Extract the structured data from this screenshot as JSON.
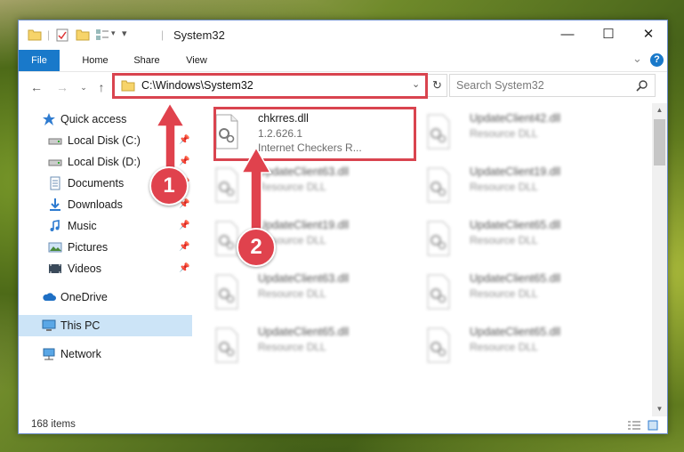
{
  "window": {
    "title": "System32",
    "controls": {
      "minimize": "—",
      "maximize": "☐",
      "close": "✕"
    }
  },
  "ribbon": {
    "tabs": [
      "File",
      "Home",
      "Share",
      "View"
    ],
    "help_glyph": "?",
    "expand_glyph": "⌄"
  },
  "nav": {
    "address": "C:\\Windows\\System32",
    "search_placeholder": "Search System32"
  },
  "sidebar": {
    "items": [
      {
        "label": "Quick access",
        "icon": "star-icon",
        "pinned": false
      },
      {
        "label": "Local Disk (C:)",
        "icon": "drive-icon",
        "pinned": true
      },
      {
        "label": "Local Disk (D:)",
        "icon": "drive-icon",
        "pinned": true
      },
      {
        "label": "Documents",
        "icon": "documents-icon",
        "pinned": true
      },
      {
        "label": "Downloads",
        "icon": "downloads-icon",
        "pinned": true
      },
      {
        "label": "Music",
        "icon": "music-icon",
        "pinned": true
      },
      {
        "label": "Pictures",
        "icon": "pictures-icon",
        "pinned": true
      },
      {
        "label": "Videos",
        "icon": "videos-icon",
        "pinned": true
      },
      {
        "label": "OneDrive",
        "icon": "cloud-icon",
        "pinned": false
      },
      {
        "label": "This PC",
        "icon": "computer-icon",
        "pinned": false,
        "selected": true
      },
      {
        "label": "Network",
        "icon": "network-icon",
        "pinned": false
      }
    ]
  },
  "files": {
    "highlighted": {
      "name": "chkrres.dll",
      "version": "1.2.626.1",
      "description": "Internet Checkers R..."
    },
    "others": [
      {
        "name": "UpdateClient42.dll",
        "type": "Resource DLL"
      },
      {
        "name": "UpdateClient63.dll",
        "type": "Resource DLL"
      },
      {
        "name": "UpdateClient19.dll",
        "type": "Resource DLL"
      },
      {
        "name": "UpdateClient19.dll",
        "type": "Resource DLL"
      },
      {
        "name": "UpdateClient65.dll",
        "type": "Resource DLL"
      },
      {
        "name": "UpdateClient63.dll",
        "type": "Resource DLL"
      },
      {
        "name": "UpdateClient65.dll",
        "type": "Resource DLL"
      },
      {
        "name": "UpdateClient65.dll",
        "type": "Resource DLL"
      },
      {
        "name": "UpdateClient65.dll",
        "type": "Resource DLL"
      }
    ]
  },
  "status": {
    "item_count": "168 items"
  },
  "annotations": {
    "step1": "1",
    "step2": "2",
    "color": "#d9444f"
  }
}
